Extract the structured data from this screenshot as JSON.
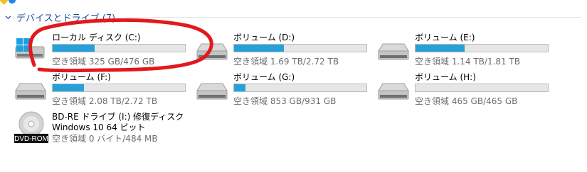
{
  "group": {
    "title": "デバイスとドライブ (7)"
  },
  "drives": [
    {
      "name": "ローカル ディスク (C:)",
      "free_text": "空き領域 325 GB/476 GB",
      "used_fraction": 0.317,
      "icon": "windows-drive-icon"
    },
    {
      "name": "ボリューム (D:)",
      "free_text": "空き領域 1.69 TB/2.72 TB",
      "used_fraction": 0.379,
      "icon": "hard-drive-icon"
    },
    {
      "name": "ボリューム (E:)",
      "free_text": "空き領域 1.14 TB/1.81 TB",
      "used_fraction": 0.37,
      "icon": "hard-drive-icon"
    },
    {
      "name": "ボリューム (F:)",
      "free_text": "空き領域 2.08 TB/2.72 TB",
      "used_fraction": 0.235,
      "icon": "hard-drive-icon"
    },
    {
      "name": "ボリューム (G:)",
      "free_text": "空き領域 853 GB/931 GB",
      "used_fraction": 0.084,
      "icon": "hard-drive-icon"
    },
    {
      "name": "ボリューム (H:)",
      "free_text": "空き領域 465 GB/465 GB",
      "used_fraction": 0.0,
      "icon": "hard-drive-icon"
    }
  ],
  "optical": {
    "line1": "BD-RE ドライブ (I:) 修復ディスク",
    "line2": "Windows 10 64 ビット",
    "line3": "空き領域 0 バイト/484 MB",
    "badge": "DVD-ROM",
    "icon": "dvd-rom-icon"
  },
  "colors": {
    "accent": "#26a0da",
    "header": "#1f4e9a",
    "annotation": "#e3181e"
  }
}
